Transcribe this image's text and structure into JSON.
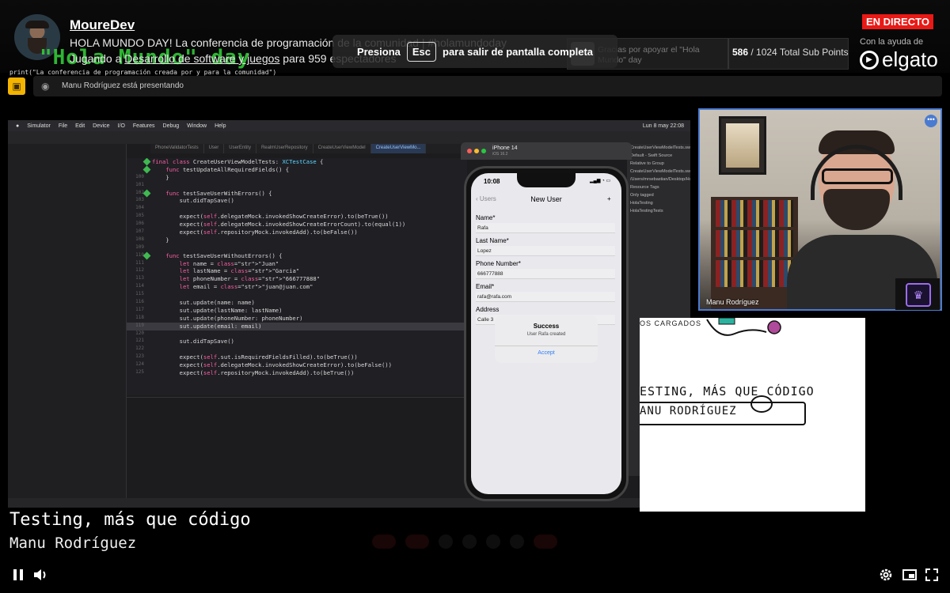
{
  "channel": {
    "name": "MoureDev",
    "title_line": "HOLA MUNDO DAY! La conferencia de programación de la comunidad | #holamundoday",
    "sub_prefix": "Jugando a ",
    "category": "Desarrollo de software y juegos",
    "sub_suffix": " para 959 espectadores"
  },
  "live_badge": "EN DIRECTO",
  "sponsor": {
    "label": "Con la ayuda de",
    "brand": "elgato"
  },
  "sub_goal": {
    "text": "Gracias por apoyar el \"Hola Mundo\" day",
    "current": "586",
    "total_label": " / 1024 Total Sub Points",
    "progress": 0.572
  },
  "fullscreen_hint": {
    "pre": "Presiona",
    "key": "Esc",
    "post": "para salir de pantalla completa"
  },
  "overlay": {
    "logo": "\"Hola Mundo\" day",
    "print_line": "print(\"La conferencia de programación creada por y para la comunidad\")"
  },
  "presenting": {
    "label": "Manu Rodríguez está presentando"
  },
  "mac": {
    "menu": [
      "Simulator",
      "File",
      "Edit",
      "Device",
      "I/O",
      "Features",
      "Debug",
      "Window",
      "Help"
    ],
    "clock": "Lun 8 may 22:08",
    "tabs": [
      "PhoneValidatorTests",
      "User",
      "UserEntity",
      "RealmUserRepository",
      "CreateUserViewModel",
      "CreateUserViewMo..."
    ],
    "inspector": [
      "CreateUserViewModelTests.swift",
      "Default - Swift Source",
      "Relative to Group",
      "CreateUserViewModelTests.swift",
      "/Users/mrsebastian/Desktop/HolaMundoDay - Taller/HolaTesting/HolaTestingTests/Users/Application/Create/CreateUserViewModelTests.swift",
      "Resource Tags",
      "Only tagged",
      "HolaTesting",
      "HolaTestingTests"
    ],
    "code": [
      {
        "n": "",
        "t": "final class CreateUserViewModelTests: XCTestCase {",
        "dia": true,
        "hl": false
      },
      {
        "n": "",
        "t": "    func testUpdateAllRequiredFields() {",
        "dia": true,
        "hl": false
      },
      {
        "n": "100",
        "t": "    }",
        "dia": false,
        "hl": false
      },
      {
        "n": "101",
        "t": "",
        "dia": false,
        "hl": false
      },
      {
        "n": "102",
        "t": "    func testSaveUserWithErrors() {",
        "dia": true,
        "hl": false
      },
      {
        "n": "103",
        "t": "        sut.didTapSave()",
        "dia": false,
        "hl": false
      },
      {
        "n": "104",
        "t": "",
        "dia": false,
        "hl": false
      },
      {
        "n": "105",
        "t": "        expect(self.delegateMock.invokedShowCreateError).to(beTrue())",
        "dia": false,
        "hl": false
      },
      {
        "n": "106",
        "t": "        expect(self.delegateMock.invokedShowCreateErrorCount).to(equal(1))",
        "dia": false,
        "hl": false
      },
      {
        "n": "107",
        "t": "        expect(self.repositoryMock.invokedAdd).to(beFalse())",
        "dia": false,
        "hl": false
      },
      {
        "n": "108",
        "t": "    }",
        "dia": false,
        "hl": false
      },
      {
        "n": "109",
        "t": "",
        "dia": false,
        "hl": false
      },
      {
        "n": "110",
        "t": "    func testSaveUserWithoutErrors() {",
        "dia": true,
        "hl": false
      },
      {
        "n": "111",
        "t": "        let name = \"Juan\"",
        "dia": false,
        "hl": false
      },
      {
        "n": "112",
        "t": "        let lastName = \"Garcia\"",
        "dia": false,
        "hl": false
      },
      {
        "n": "113",
        "t": "        let phoneNumber = \"666777888\"",
        "dia": false,
        "hl": false
      },
      {
        "n": "114",
        "t": "        let email = \"juan@juan.com\"",
        "dia": false,
        "hl": false
      },
      {
        "n": "115",
        "t": "",
        "dia": false,
        "hl": false
      },
      {
        "n": "116",
        "t": "        sut.update(name: name)",
        "dia": false,
        "hl": false
      },
      {
        "n": "117",
        "t": "        sut.update(lastName: lastName)",
        "dia": false,
        "hl": false
      },
      {
        "n": "118",
        "t": "        sut.update(phoneNumber: phoneNumber)",
        "dia": false,
        "hl": false
      },
      {
        "n": "119",
        "t": "        sut.update(email: email)",
        "dia": false,
        "hl": true
      },
      {
        "n": "120",
        "t": "",
        "dia": false,
        "hl": false
      },
      {
        "n": "121",
        "t": "        sut.didTapSave()",
        "dia": false,
        "hl": false
      },
      {
        "n": "122",
        "t": "",
        "dia": false,
        "hl": false
      },
      {
        "n": "123",
        "t": "        expect(self.sut.isRequiredFieldsFilled).to(beTrue())",
        "dia": false,
        "hl": false
      },
      {
        "n": "124",
        "t": "        expect(self.delegateMock.invokedShowCreateError).to(beFalse())",
        "dia": false,
        "hl": false
      },
      {
        "n": "125",
        "t": "        expect(self.repositoryMock.invokedAdd).to(beTrue())",
        "dia": false,
        "hl": false
      }
    ],
    "simulator": {
      "device": "iPhone 14",
      "os": "iOS 16.2",
      "time": "10:08",
      "back": "Users",
      "nav_title": "New User",
      "plus": "+",
      "fields": [
        {
          "label": "Name*",
          "value": "Rafa"
        },
        {
          "label": "Last Name*",
          "value": "Lopez"
        },
        {
          "label": "Phone Number*",
          "value": "666777888"
        },
        {
          "label": "Email*",
          "value": "rafa@rafa.com"
        },
        {
          "label": "Address",
          "value": "Calle 3"
        }
      ],
      "alert": {
        "title": "Success",
        "message": "User Rafa created",
        "button": "Accept"
      }
    }
  },
  "cartoon": {
    "cargados": "OS CARGADOS",
    "title": "ESTING, MÁS QUE CÓDIGO",
    "name": "ANU RODRÍGUEZ"
  },
  "webcam": {
    "name": "Manu Rodríguez"
  },
  "captions": {
    "title": "Testing, más que código",
    "name": "Manu Rodríguez"
  },
  "colors": {
    "live": "#e91916",
    "accent": "#4a7bd0",
    "crown": "#9b6cf0"
  },
  "icons": [
    "share-screen-icon",
    "presenter-icon",
    "elgato-logo-icon",
    "pause-icon",
    "volume-icon",
    "settings-icon",
    "picture-in-picture-icon",
    "fullscreen-icon",
    "crown-icon"
  ]
}
